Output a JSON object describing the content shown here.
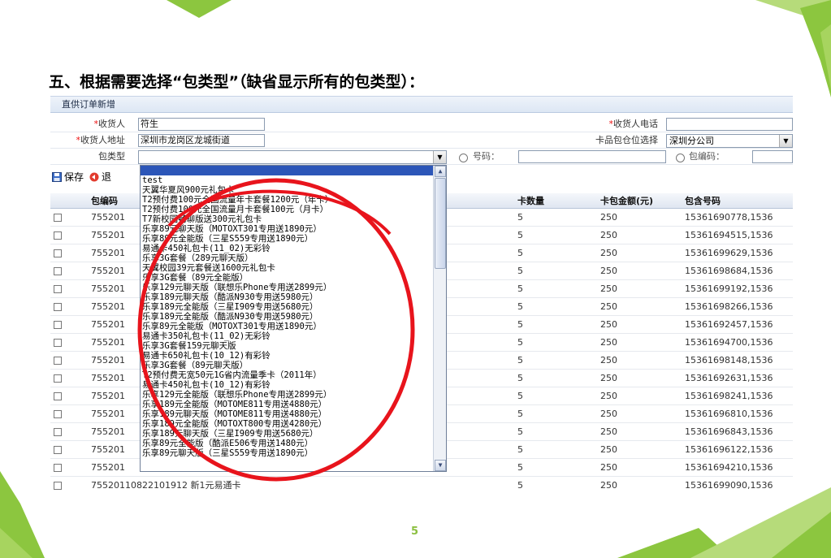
{
  "slide": {
    "title": "五、根据需要选择“包类型”（缺省显示所有的包类型）：",
    "page_number": "5"
  },
  "panel": {
    "header": "直供订单新增",
    "form": {
      "recipient_label": "收货人",
      "recipient_value": "符生",
      "phone_label": "收货人电话",
      "phone_value": "",
      "address_label": "收货人地址",
      "address_value": "深圳市龙岗区龙城街道",
      "warehouse_label": "卡品包仓位选择",
      "warehouse_value": "深圳分公司",
      "package_type_label": "包类型",
      "package_type_value": "",
      "number_label": "号码：",
      "number_value": "",
      "package_code_label": "包编码：",
      "package_code_value": ""
    },
    "toolbar": {
      "save_label": "保存",
      "back_label": "退"
    },
    "table": {
      "headers": {
        "code": "包编码",
        "card_count": "卡数量",
        "amount": "卡包金额(元)",
        "numbers": "包含号码"
      },
      "rows": [
        {
          "code": "755201",
          "card_count": "5",
          "amount": "250",
          "numbers": "15361690778,1536"
        },
        {
          "code": "755201",
          "card_count": "5",
          "amount": "250",
          "numbers": "15361694515,1536"
        },
        {
          "code": "755201",
          "card_count": "5",
          "amount": "250",
          "numbers": "15361699629,1536"
        },
        {
          "code": "755201",
          "card_count": "5",
          "amount": "250",
          "numbers": "15361698684,1536"
        },
        {
          "code": "755201",
          "card_count": "5",
          "amount": "250",
          "numbers": "15361699192,1536"
        },
        {
          "code": "755201",
          "card_count": "5",
          "amount": "250",
          "numbers": "15361698266,1536"
        },
        {
          "code": "755201",
          "card_count": "5",
          "amount": "250",
          "numbers": "15361692457,1536"
        },
        {
          "code": "755201",
          "card_count": "5",
          "amount": "250",
          "numbers": "15361694700,1536"
        },
        {
          "code": "755201",
          "card_count": "5",
          "amount": "250",
          "numbers": "15361698148,1536"
        },
        {
          "code": "755201",
          "card_count": "5",
          "amount": "250",
          "numbers": "15361692631,1536"
        },
        {
          "code": "755201",
          "card_count": "5",
          "amount": "250",
          "numbers": "15361698241,1536"
        },
        {
          "code": "755201",
          "card_count": "5",
          "amount": "250",
          "numbers": "15361696810,1536"
        },
        {
          "code": "755201",
          "card_count": "5",
          "amount": "250",
          "numbers": "15361696843,1536"
        },
        {
          "code": "755201",
          "card_count": "5",
          "amount": "250",
          "numbers": "15361696122,1536"
        },
        {
          "code": "755201",
          "card_count": "5",
          "amount": "250",
          "numbers": "15361694210,1536"
        },
        {
          "code": "75520110822101912 新1元易通卡",
          "card_count": "5",
          "amount": "250",
          "numbers": "15361699090,1536"
        }
      ]
    },
    "dropdown": {
      "options": [
        "test",
        "天翼华夏风900元礼包卡",
        "T2预付费100元全国流量年卡套餐1200元（年卡）",
        "T2预付费100元全国流量月卡套餐100元（月卡）",
        "T7新校园畅聊版送300元礼包卡",
        "乐享89元聊天版（MOTOXT301专用送1890元）",
        "乐享89元全能版（三星S559专用送1890元）",
        "易通卡450礼包卡(11_02)无彩铃",
        "乐享3G套餐（289元聊天版）",
        "天翼校园39元套餐送1600元礼包卡",
        "乐享3G套餐（89元全能版）",
        "乐享129元聊天版（联想乐Phone专用送2899元）",
        "乐享189元聊天版（酷派N930专用送5980元）",
        "乐享189元全能版（三星I909专用送5680元）",
        "乐享189元全能版（酷派N930专用送5980元）",
        "乐享89元全能版（MOTOXT301专用送1890元）",
        "易通卡350礼包卡(11_02)无彩铃",
        "乐享3G套餐159元聊天版",
        "易通卡650礼包卡(10_12)有彩铃",
        "乐享3G套餐（89元聊天版）",
        "T2预付费无宽50元1G省内流量季卡（2011年）",
        "易通卡450礼包卡(10_12)有彩铃",
        "乐享129元全能版（联想乐Phone专用送2899元）",
        "乐享189元全能版（MOTOME811专用送4880元）",
        "乐享189元聊天版（MOTOME811专用送4880元）",
        "乐享189元全能版（MOTOXT800专用送4280元）",
        "乐享189元聊天版（三星I909专用送5680元）",
        "乐享89元全能版（酷派E506专用送1480元）",
        "乐享89元聊天版（三星S559专用送1890元）"
      ]
    }
  },
  "colors": {
    "deco_green": "#8cc63f",
    "annotation_red": "#e8141c",
    "selection_blue": "#2c56b8"
  }
}
